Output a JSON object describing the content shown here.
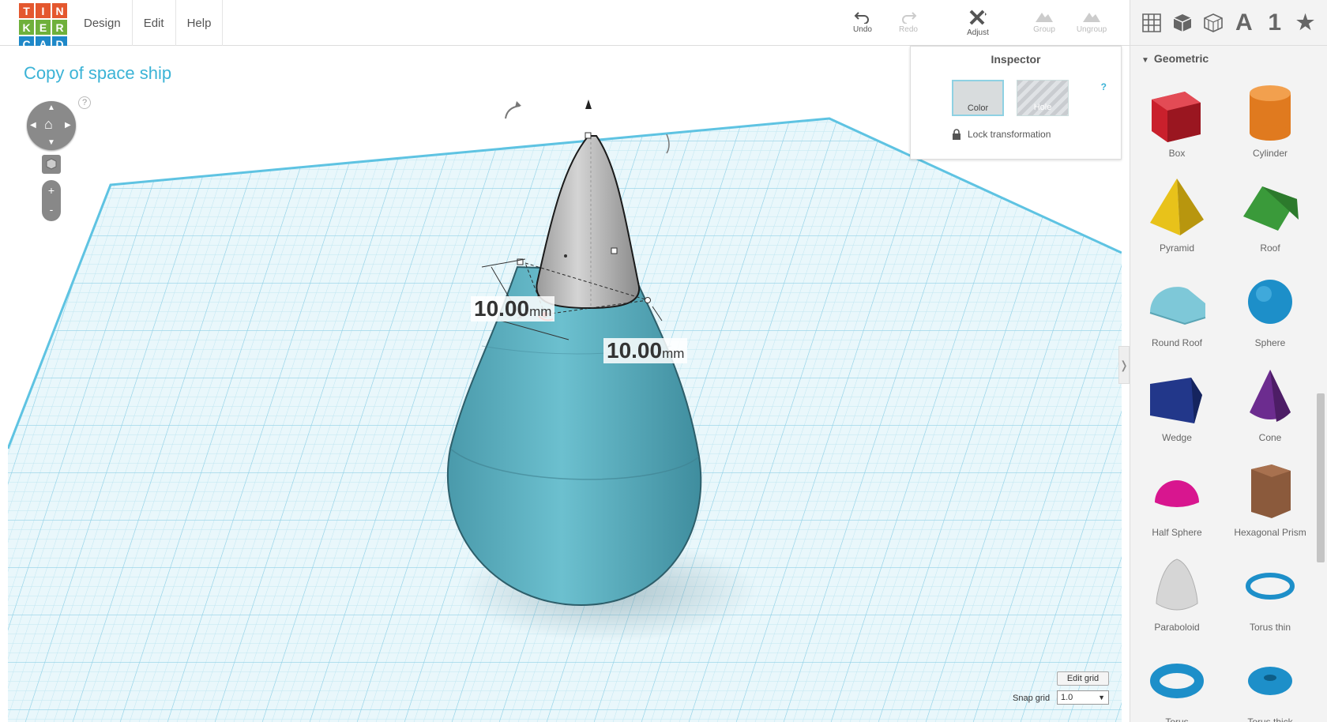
{
  "logo": {
    "letters": [
      "T",
      "I",
      "N",
      "K",
      "E",
      "R",
      "C",
      "A",
      "D"
    ],
    "colors": [
      "#e4572e",
      "#e4572e",
      "#e4572e",
      "#6fb03b",
      "#6fb03b",
      "#6fb03b",
      "#1e88c8",
      "#1e88c8",
      "#1e88c8"
    ]
  },
  "menu": [
    "Design",
    "Edit",
    "Help"
  ],
  "toolbar": {
    "undo": "Undo",
    "redo": "Redo",
    "adjust": "Adjust",
    "group": "Group",
    "ungroup": "Ungroup"
  },
  "view_buttons": {
    "text_label": "A",
    "number_label": "1",
    "star": "★"
  },
  "design_title": "Copy of space ship",
  "nav": {
    "help": "?",
    "zoom_in": "+",
    "zoom_out": "-"
  },
  "inspector": {
    "title": "Inspector",
    "color_label": "Color",
    "hole_label": "Hole",
    "help": "?",
    "lock_label": "Lock transformation"
  },
  "dimensions": [
    {
      "value": "10.00",
      "unit": "mm"
    },
    {
      "value": "10.00",
      "unit": "mm"
    }
  ],
  "grid": {
    "edit_label": "Edit grid",
    "snap_label": "Snap grid",
    "snap_value": "1.0"
  },
  "library": {
    "category": "Geometric",
    "shapes": [
      {
        "name": "Box",
        "icon": "box-icon",
        "color": "#c9202c"
      },
      {
        "name": "Cylinder",
        "icon": "cylinder-icon",
        "color": "#e07a1f"
      },
      {
        "name": "Pyramid",
        "icon": "pyramid-icon",
        "color": "#e8c21a"
      },
      {
        "name": "Roof",
        "icon": "roof-icon",
        "color": "#3a9a3a"
      },
      {
        "name": "Round Roof",
        "icon": "round-roof-icon",
        "color": "#7ec8d8"
      },
      {
        "name": "Sphere",
        "icon": "sphere-icon",
        "color": "#1d8fc9"
      },
      {
        "name": "Wedge",
        "icon": "wedge-icon",
        "color": "#22378a"
      },
      {
        "name": "Cone",
        "icon": "cone-icon",
        "color": "#6c2c8f"
      },
      {
        "name": "Half Sphere",
        "icon": "half-sphere-icon",
        "color": "#d8168f"
      },
      {
        "name": "Hexagonal Prism",
        "icon": "hexagonal-prism-icon",
        "color": "#8b5a3c"
      },
      {
        "name": "Paraboloid",
        "icon": "paraboloid-icon",
        "color": "#d6d6d6"
      },
      {
        "name": "Torus thin",
        "icon": "torus-thin-icon",
        "color": "#1d8fc9"
      },
      {
        "name": "Torus",
        "icon": "torus-icon",
        "color": "#1d8fc9"
      },
      {
        "name": "Torus thick",
        "icon": "torus-thick-icon",
        "color": "#1d8fc9"
      }
    ]
  }
}
